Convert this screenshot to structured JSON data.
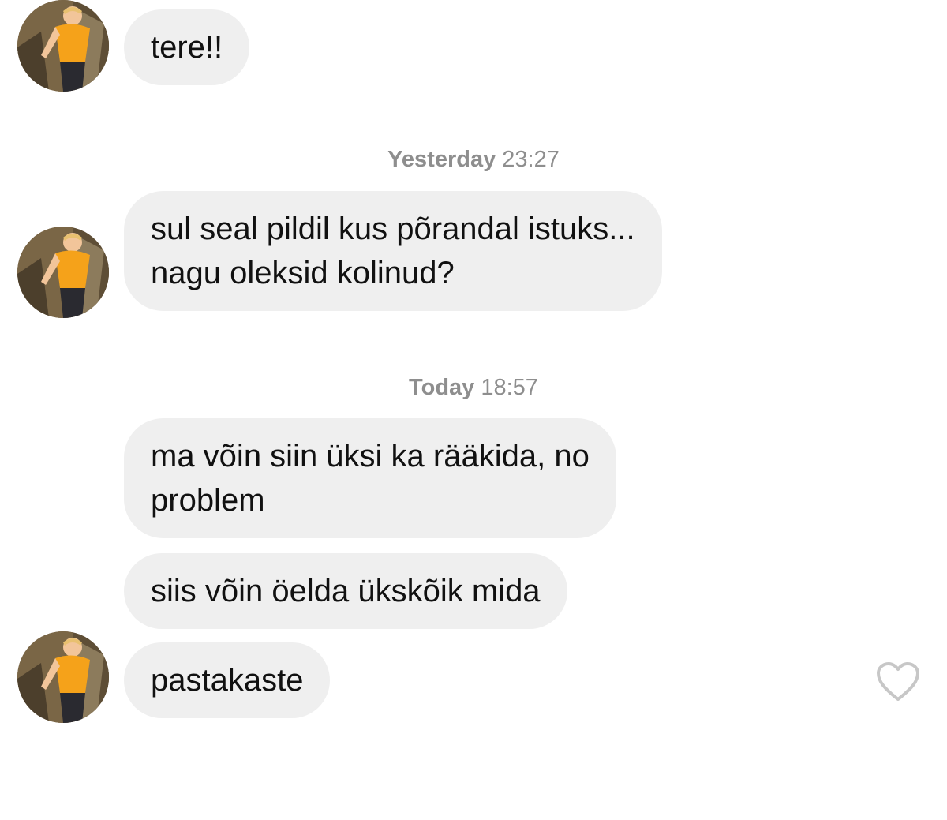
{
  "conversation": {
    "messages": [
      {
        "lines": [
          "tere!!"
        ]
      },
      {
        "lines": [
          "sul seal pildil kus põrandal istuks...",
          "nagu oleksid kolinud?"
        ]
      },
      {
        "lines": [
          "ma võin siin üksi ka rääkida, no",
          "problem"
        ]
      },
      {
        "lines": [
          "siis võin öelda ükskõik mida"
        ]
      },
      {
        "lines": [
          "pastakaste"
        ]
      }
    ],
    "timestamps": [
      {
        "day": "Yesterday",
        "time": "23:27"
      },
      {
        "day": "Today",
        "time": "18:57"
      }
    ]
  },
  "icons": {
    "avatar": "user-avatar-photo",
    "like": "heart-outline-icon"
  },
  "colors": {
    "bubble_background": "#efefef",
    "timestamp_text": "#8e8e8e",
    "message_text": "#111111",
    "heart_outline": "#c7c7c7"
  }
}
